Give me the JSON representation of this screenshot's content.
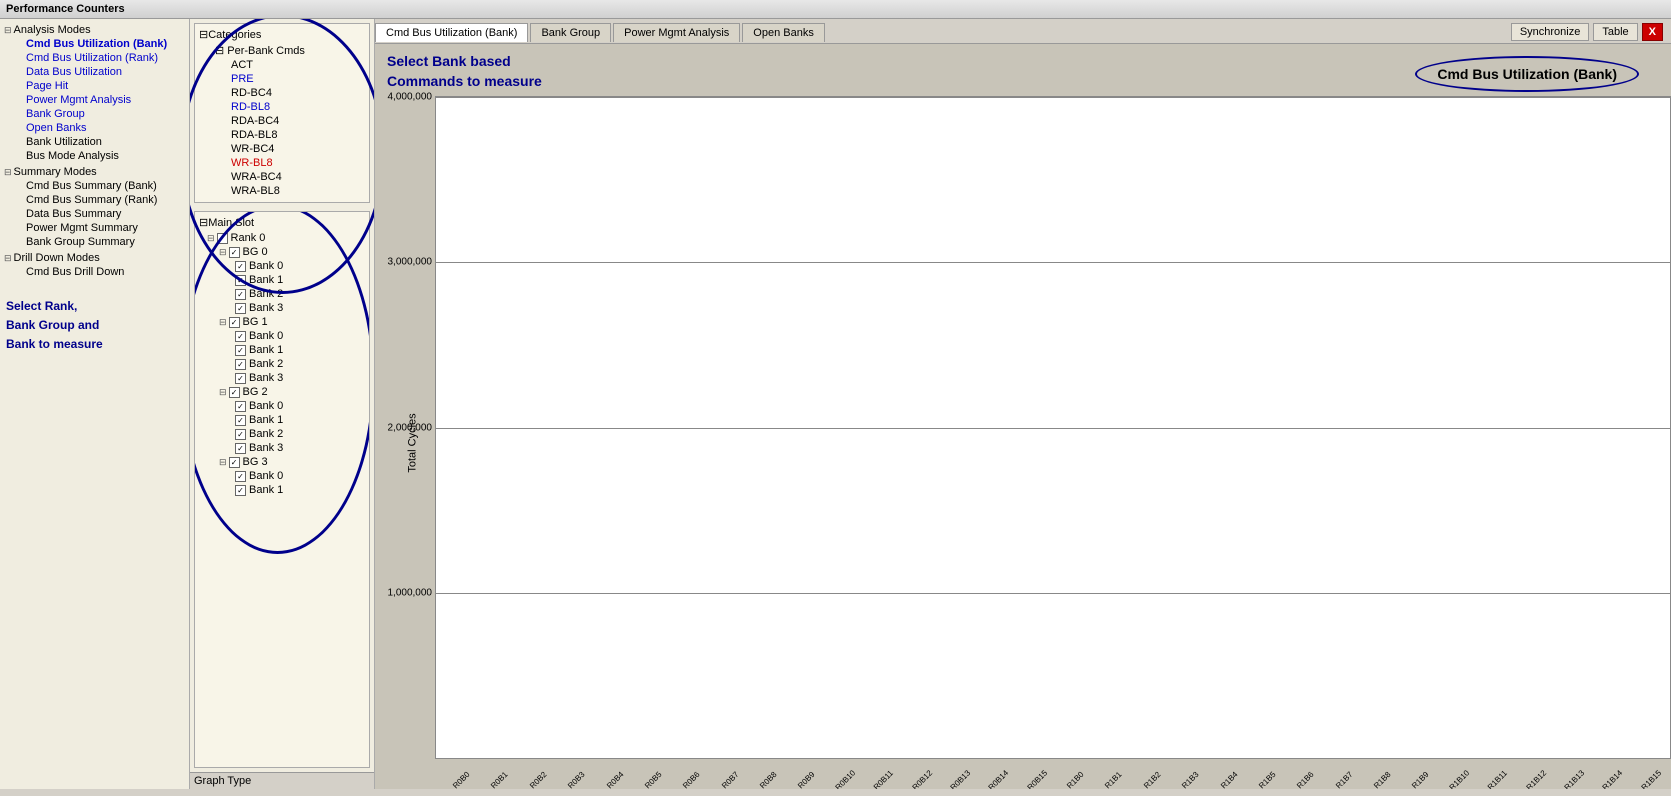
{
  "titleBar": {
    "label": "Performance Counters"
  },
  "topTabs": [
    {
      "id": "cmd-bus-bank",
      "label": "Cmd Bus Utilization (Bank)",
      "active": true
    },
    {
      "id": "bank-group",
      "label": "Bank Group",
      "active": false
    },
    {
      "id": "power-mgmt",
      "label": "Power Mgmt Analysis",
      "active": false
    },
    {
      "id": "open-banks",
      "label": "Open Banks",
      "active": false
    }
  ],
  "topActions": {
    "sync": "Synchronize",
    "table": "Table",
    "close": "X"
  },
  "leftPanel": {
    "analysisModes": {
      "label": "Analysis Modes",
      "items": [
        {
          "label": "Cmd Bus Utilization (Bank)",
          "type": "link",
          "indent": 1
        },
        {
          "label": "Cmd Bus Utilization (Rank)",
          "type": "link",
          "indent": 1
        },
        {
          "label": "Data Bus Utilization",
          "type": "link",
          "indent": 1
        },
        {
          "label": "Page Hit",
          "type": "link",
          "indent": 1
        },
        {
          "label": "Power Mgmt Analysis",
          "type": "link",
          "indent": 1
        },
        {
          "label": "Bank Group",
          "type": "link",
          "indent": 1
        },
        {
          "label": "Open Banks",
          "type": "link",
          "indent": 1
        },
        {
          "label": "Bank Utilization",
          "type": "black",
          "indent": 1
        },
        {
          "label": "Bus Mode Analysis",
          "type": "black",
          "indent": 1
        }
      ]
    },
    "summaryModes": {
      "label": "Summary Modes",
      "items": [
        {
          "label": "Cmd Bus Summary (Bank)",
          "type": "black",
          "indent": 1
        },
        {
          "label": "Cmd Bus Summary (Rank)",
          "type": "black",
          "indent": 1
        },
        {
          "label": "Data Bus Summary",
          "type": "black",
          "indent": 1
        },
        {
          "label": "Power Mgmt Summary",
          "type": "black",
          "indent": 1
        },
        {
          "label": "Bank Group Summary",
          "type": "black",
          "indent": 1
        }
      ]
    },
    "drillDownModes": {
      "label": "Drill Down Modes",
      "items": [
        {
          "label": "Cmd Bus Drill Down",
          "type": "black",
          "indent": 1
        }
      ]
    },
    "selectInfo": "Select Rank,\nBank Group and\nBank to measure"
  },
  "categoriesPanel": {
    "title": "Categories",
    "perBankCmds": "Per-Bank Cmds",
    "items": [
      {
        "label": "ACT",
        "color": "black"
      },
      {
        "label": "PRE",
        "color": "blue"
      },
      {
        "label": "RD-BC4",
        "color": "black"
      },
      {
        "label": "RD-BL8",
        "color": "blue"
      },
      {
        "label": "RDA-BC4",
        "color": "black"
      },
      {
        "label": "RDA-BL8",
        "color": "black"
      },
      {
        "label": "WR-BC4",
        "color": "black"
      },
      {
        "label": "WR-BL8",
        "color": "red"
      },
      {
        "label": "WRA-BC4",
        "color": "black"
      },
      {
        "label": "WRA-BL8",
        "color": "black"
      }
    ]
  },
  "mainSlot": {
    "title": "Main Slot",
    "rank0": {
      "label": "Rank 0",
      "bg0": {
        "label": "BG 0",
        "banks": [
          "Bank 0",
          "Bank 1",
          "Bank 2",
          "Bank 3"
        ]
      },
      "bg1": {
        "label": "BG 1",
        "banks": [
          "Bank 0",
          "Bank 1",
          "Bank 2",
          "Bank 3"
        ]
      },
      "bg2": {
        "label": "BG 2",
        "banks": [
          "Bank 0",
          "Bank 1",
          "Bank 2",
          "Bank 3"
        ]
      },
      "bg3": {
        "label": "BG 3",
        "banks": [
          "Bank 0",
          "Bank 1"
        ]
      }
    }
  },
  "chart": {
    "titleLeft": "Select Bank based\nCommands to measure",
    "titleRight": "Cmd Bus Utilization (Bank)",
    "yAxisLabel": "Total Cycles",
    "yAxisValues": [
      "4,000,000",
      "3,000,000",
      "2,000,000",
      "1,000,000"
    ],
    "colors": {
      "red": "#cc0000",
      "blue": "#2222cc",
      "teal": "#00aaaa",
      "purple": "#9944cc"
    },
    "xLabels": [
      "R0B0",
      "R0B1",
      "R0B2",
      "R0B3",
      "R0B4",
      "R0B5",
      "R0B6",
      "R0B7",
      "R0B8",
      "R0B9",
      "R0B10",
      "R0B11",
      "R0B12",
      "R0B13",
      "R0B14",
      "R0B15",
      "R1B0",
      "R1B1",
      "R1B2",
      "R1B3",
      "R1B4",
      "R1B5",
      "R1B6",
      "R1B7",
      "R1B8",
      "R1B9",
      "R1B10",
      "R1B11",
      "R1B12",
      "R1B13",
      "R1B14",
      "R1B15"
    ],
    "barGroups": [
      {
        "red": 88,
        "blue": 44,
        "teal": 2,
        "purple": 0
      },
      {
        "red": 88,
        "blue": 44,
        "teal": 2,
        "purple": 0
      },
      {
        "red": 88,
        "blue": 44,
        "teal": 2,
        "purple": 0
      },
      {
        "red": 88,
        "blue": 44,
        "teal": 2,
        "purple": 0
      },
      {
        "red": 88,
        "blue": 44,
        "teal": 2,
        "purple": 0
      },
      {
        "red": 88,
        "blue": 44,
        "teal": 2,
        "purple": 0
      },
      {
        "red": 88,
        "blue": 44,
        "teal": 2,
        "purple": 0
      },
      {
        "red": 88,
        "blue": 44,
        "teal": 2,
        "purple": 0
      },
      {
        "red": 88,
        "blue": 44,
        "teal": 2,
        "purple": 0
      },
      {
        "red": 88,
        "blue": 44,
        "teal": 2,
        "purple": 0
      },
      {
        "red": 88,
        "blue": 44,
        "teal": 2,
        "purple": 0
      },
      {
        "red": 88,
        "blue": 44,
        "teal": 2,
        "purple": 0
      },
      {
        "red": 88,
        "blue": 44,
        "teal": 2,
        "purple": 0
      },
      {
        "red": 88,
        "blue": 44,
        "teal": 2,
        "purple": 0
      },
      {
        "red": 88,
        "blue": 44,
        "teal": 2,
        "purple": 0
      },
      {
        "red": 88,
        "blue": 44,
        "teal": 50,
        "purple": 12
      },
      {
        "red": 88,
        "blue": 44,
        "teal": 2,
        "purple": 0
      },
      {
        "red": 88,
        "blue": 44,
        "teal": 2,
        "purple": 0
      },
      {
        "red": 88,
        "blue": 44,
        "teal": 2,
        "purple": 0
      },
      {
        "red": 88,
        "blue": 44,
        "teal": 2,
        "purple": 0
      },
      {
        "red": 88,
        "blue": 44,
        "teal": 2,
        "purple": 0
      },
      {
        "red": 88,
        "blue": 44,
        "teal": 2,
        "purple": 0
      },
      {
        "red": 88,
        "blue": 44,
        "teal": 2,
        "purple": 0
      },
      {
        "red": 88,
        "blue": 44,
        "teal": 2,
        "purple": 0
      },
      {
        "red": 88,
        "blue": 44,
        "teal": 2,
        "purple": 0
      },
      {
        "red": 88,
        "blue": 44,
        "teal": 2,
        "purple": 0
      },
      {
        "red": 88,
        "blue": 44,
        "teal": 2,
        "purple": 0
      },
      {
        "red": 88,
        "blue": 44,
        "teal": 2,
        "purple": 0
      },
      {
        "red": 88,
        "blue": 44,
        "teal": 2,
        "purple": 0
      },
      {
        "red": 88,
        "blue": 44,
        "teal": 2,
        "purple": 0
      },
      {
        "red": 88,
        "blue": 44,
        "teal": 2,
        "purple": 0
      },
      {
        "red": 88,
        "blue": 44,
        "teal": 50,
        "purple": 12
      }
    ]
  },
  "bottomBar": {
    "label": "Graph Type"
  }
}
